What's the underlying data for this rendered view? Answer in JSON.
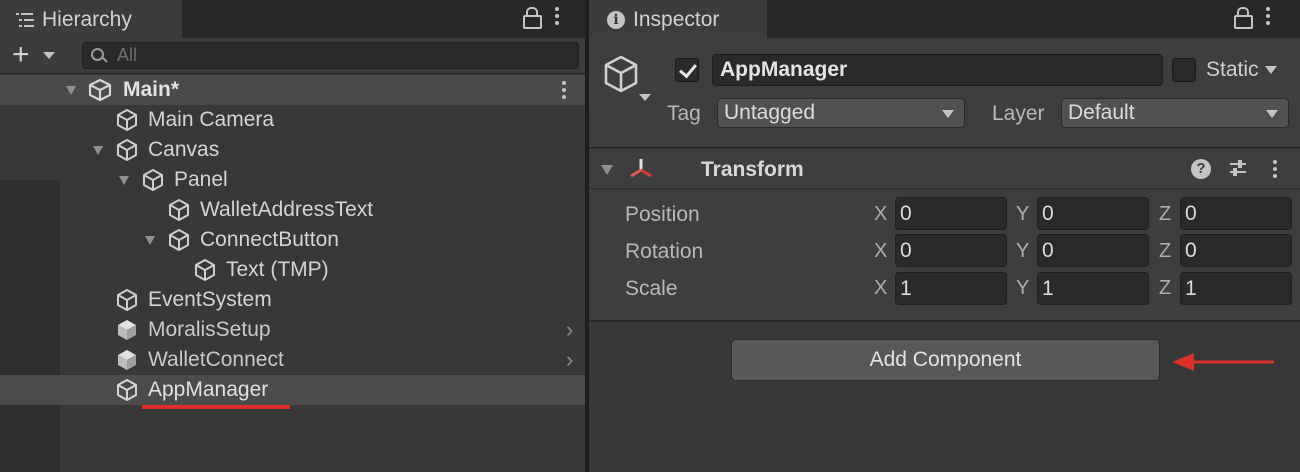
{
  "hierarchy": {
    "tab_label": "Hierarchy",
    "search": {
      "placeholder": "All"
    },
    "scene": {
      "label": "Main*"
    },
    "items": [
      {
        "label": "Main Camera"
      },
      {
        "label": "Canvas"
      },
      {
        "label": "Panel"
      },
      {
        "label": "WalletAddressText"
      },
      {
        "label": "ConnectButton"
      },
      {
        "label": "Text (TMP)"
      },
      {
        "label": "EventSystem"
      },
      {
        "label": "MoralisSetup"
      },
      {
        "label": "WalletConnect"
      },
      {
        "label": "AppManager"
      }
    ]
  },
  "inspector": {
    "tab_label": "Inspector",
    "object_name": "AppManager",
    "active": true,
    "static_label": "Static",
    "static_checked": false,
    "tag_label": "Tag",
    "tag_value": "Untagged",
    "layer_label": "Layer",
    "layer_value": "Default",
    "component": {
      "title": "Transform",
      "properties": [
        {
          "label": "Position",
          "x": "0",
          "y": "0",
          "z": "0"
        },
        {
          "label": "Rotation",
          "x": "0",
          "y": "0",
          "z": "0"
        },
        {
          "label": "Scale",
          "x": "1",
          "y": "1",
          "z": "1"
        }
      ],
      "axis_labels": {
        "x": "X",
        "y": "Y",
        "z": "Z"
      }
    },
    "add_component_label": "Add Component"
  },
  "colors": {
    "annotation_red": "#d9302a",
    "panel_bg": "#383838",
    "selection_bg": "#4b4b4b"
  },
  "icons": {
    "hierarchy_tab": "list-icon",
    "inspector_tab": "info-icon",
    "scene": "unity-logo-icon",
    "game_object": "cube-outline-icon",
    "prefab": "cube-solid-icon",
    "transform": "axis-icon"
  }
}
